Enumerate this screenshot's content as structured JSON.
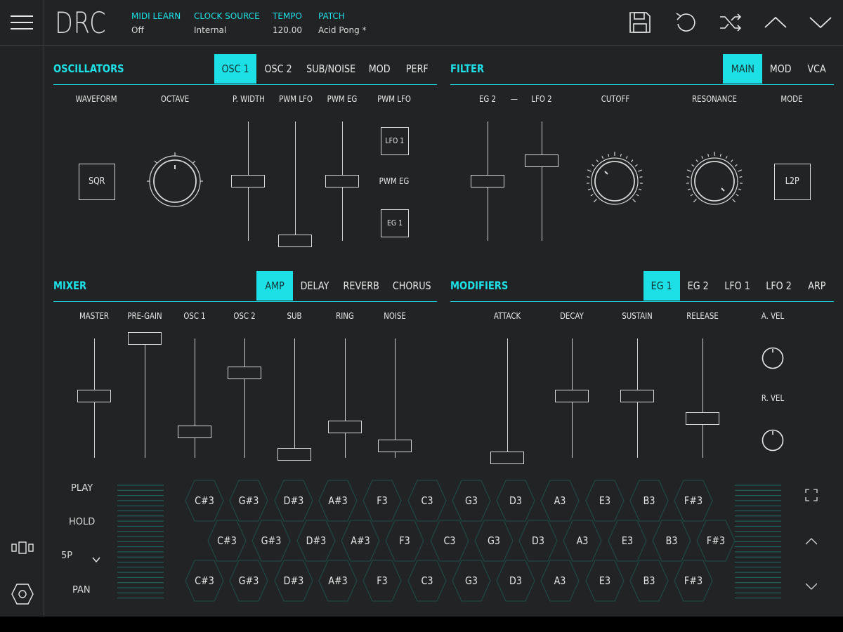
{
  "app": {
    "logo": "DRC"
  },
  "header": {
    "items": [
      {
        "label": "MIDI LEARN",
        "value": "Off"
      },
      {
        "label": "CLOCK SOURCE",
        "value": "Internal"
      },
      {
        "label": "TEMPO",
        "value": "120.00"
      },
      {
        "label": "PATCH",
        "value": "Acid Pong *"
      }
    ],
    "icons": [
      "menu-icon",
      "save-icon",
      "undo-icon",
      "shuffle-icon",
      "chevron-up-icon",
      "chevron-down-icon"
    ]
  },
  "oscillators": {
    "title": "OSCILLATORS",
    "tabs": [
      "OSC 1",
      "OSC 2",
      "SUB/NOISE",
      "MOD",
      "PERF"
    ],
    "active_tab": "OSC 1",
    "labels": [
      "WAVEFORM",
      "OCTAVE",
      "P. WIDTH",
      "PWM LFO",
      "PWM EG",
      "PWM LFO"
    ],
    "waveform": "SQR",
    "pwm_source_top": "LFO 1",
    "pwm_source_mid": "PWM EG",
    "pwm_source_bottom": "EG 1",
    "sliders": [
      {
        "name": "p-width",
        "value": 0.5
      },
      {
        "name": "pwm-lfo",
        "value": 0.0
      },
      {
        "name": "pwm-eg",
        "value": 0.5
      }
    ]
  },
  "filter": {
    "title": "FILTER",
    "tabs": [
      "MAIN",
      "MOD",
      "VCA"
    ],
    "active_tab": "MAIN",
    "labels": {
      "eg": "EG 2",
      "dash": "—",
      "lfo": "LFO 2",
      "cutoff": "CUTOFF",
      "resonance": "RESONANCE",
      "mode": "MODE"
    },
    "mode_value": "L2P",
    "sliders": [
      {
        "name": "eg-2",
        "value": 0.5
      },
      {
        "name": "lfo-2",
        "value": 0.67
      }
    ]
  },
  "mixer": {
    "title": "MIXER",
    "tabs": [
      "AMP",
      "DELAY",
      "REVERB",
      "CHORUS"
    ],
    "active_tab": "AMP",
    "channels": [
      {
        "label": "MASTER",
        "value": 0.52
      },
      {
        "label": "PRE-GAIN",
        "value": 1.0
      },
      {
        "label": "OSC 1",
        "value": 0.22
      },
      {
        "label": "OSC 2",
        "value": 0.71
      },
      {
        "label": "SUB",
        "value": 0.03
      },
      {
        "label": "RING",
        "value": 0.26
      },
      {
        "label": "NOISE",
        "value": 0.1
      }
    ]
  },
  "modifiers": {
    "title": "MODIFIERS",
    "tabs": [
      "EG 1",
      "EG 2",
      "LFO 1",
      "LFO 2",
      "ARP"
    ],
    "active_tab": "EG 1",
    "sliders": [
      {
        "label": "ATTACK",
        "value": 0.0
      },
      {
        "label": "DECAY",
        "value": 0.52
      },
      {
        "label": "SUSTAIN",
        "value": 0.52
      },
      {
        "label": "RELEASE",
        "value": 0.33
      }
    ],
    "knob_labels": [
      "A. VEL",
      "R. VEL"
    ]
  },
  "keyboard": {
    "side_labels": {
      "play": "PLAY",
      "hold": "HOLD",
      "mode": "5P",
      "pan": "PAN"
    },
    "rows": [
      [
        "C#3",
        "G#3",
        "D#3",
        "A#3",
        "F3",
        "C3",
        "G3",
        "D3",
        "A3",
        "E3",
        "B3",
        "F#3"
      ],
      [
        "C#3",
        "G#3",
        "D#3",
        "A#3",
        "F3",
        "C3",
        "G3",
        "D3",
        "A3",
        "E3",
        "B3",
        "F#3"
      ],
      [
        "C#3",
        "G#3",
        "D#3",
        "A#3",
        "F3",
        "C3",
        "G3",
        "D3",
        "A3",
        "E3",
        "B3",
        "F#3"
      ]
    ]
  },
  "colors": {
    "accent": "#1de0e6",
    "background": "#222324",
    "line": "#d8d8d8"
  }
}
